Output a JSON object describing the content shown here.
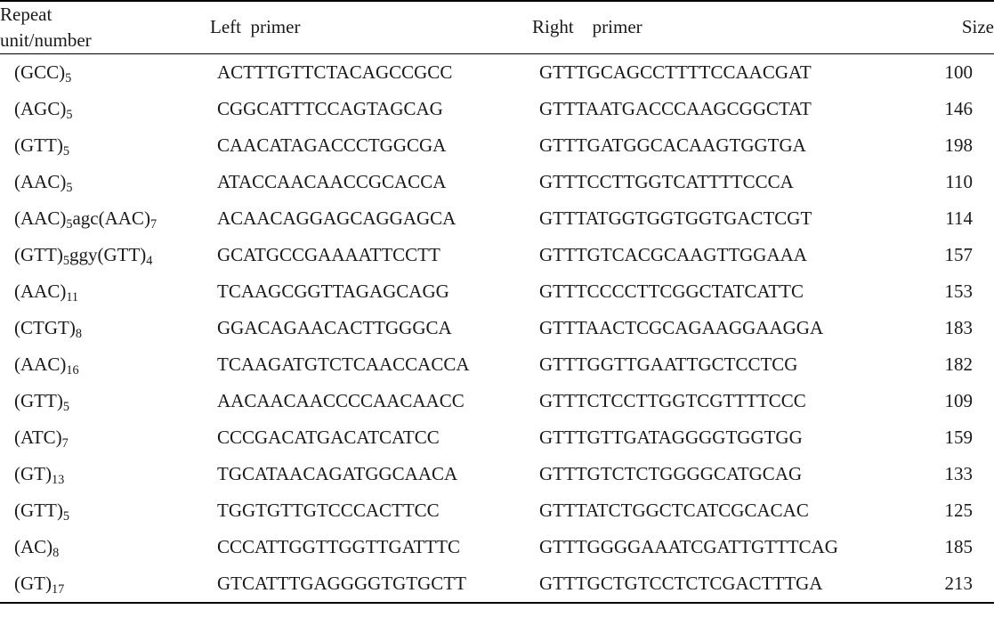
{
  "table": {
    "columns": [
      {
        "key": "repeat",
        "label_lines": [
          "Repeat",
          "unit/number"
        ],
        "align": "left"
      },
      {
        "key": "left_primer",
        "label": "Left  primer",
        "align": "left"
      },
      {
        "key": "right_primer",
        "label": "Right    primer",
        "align": "left"
      },
      {
        "key": "size",
        "label": "Size",
        "align": "right"
      }
    ],
    "rows": [
      {
        "repeat_unit": "(GCC)",
        "repeat_sub": "5",
        "repeat_extra": "",
        "repeat_display": "(GCC)5",
        "left_primer": "ACTTTGTTCTACAGCCGCC",
        "right_primer": "GTTTGCAGCCTTTTCCAACGAT",
        "size": "100"
      },
      {
        "repeat_unit": "(AGC)",
        "repeat_sub": "5",
        "repeat_extra": "",
        "repeat_display": "(AGC)5",
        "left_primer": "CGGCATTTCCAGTAGCAG",
        "right_primer": "GTTTAATGACCCAAGCGGCTAT",
        "size": "146"
      },
      {
        "repeat_unit": "(GTT)",
        "repeat_sub": "5",
        "repeat_extra": "",
        "repeat_display": "(GTT)5",
        "left_primer": "CAACATAGACCCTGGCGA",
        "right_primer": "GTTTGATGGCACAAGTGGTGA",
        "size": "198"
      },
      {
        "repeat_unit": "(AAC)",
        "repeat_sub": "5",
        "repeat_extra": "",
        "repeat_display": "(AAC)5",
        "left_primer": "ATACCAACAACCGCACCA",
        "right_primer": "GTTTCCTTGGTCATTTTCCCA",
        "size": "110"
      },
      {
        "repeat_unit": "(AAC)",
        "repeat_sub": "5",
        "repeat_extra": "agc(AAC)",
        "repeat_extra_sub": "7",
        "repeat_display": "(AAC)5agc(AAC)7",
        "left_primer": "ACAACAGGAGCAGGAGCA",
        "right_primer": "GTTTATGGTGGTGGTGACTCGT",
        "size": "114"
      },
      {
        "repeat_unit": "(GTT)",
        "repeat_sub": "5",
        "repeat_extra": "ggy(GTT)",
        "repeat_extra_sub": "4",
        "repeat_display": "(GTT)5ggy(GTT)4",
        "left_primer": "GCATGCCGAAAATTCCTT",
        "right_primer": "GTTTGTCACGCAAGTTGGAAA",
        "size": "157"
      },
      {
        "repeat_unit": "(AAC)",
        "repeat_sub": "11",
        "repeat_extra": "",
        "repeat_display": "(AAC)11",
        "left_primer": "TCAAGCGGTTAGAGCAGG",
        "right_primer": "GTTTCCCCTTCGGCTATCATTC",
        "size": "153"
      },
      {
        "repeat_unit": "(CTGT)",
        "repeat_sub": "8",
        "repeat_extra": "",
        "repeat_display": "(CTGT)8",
        "left_primer": "GGACAGAACACTTGGGCA",
        "right_primer": "GTTTAACTCGCAGAAGGAAGGA",
        "size": "183"
      },
      {
        "repeat_unit": "(AAC)",
        "repeat_sub": "16",
        "repeat_extra": "",
        "repeat_display": "(AAC)16",
        "left_primer": "TCAAGATGTCTCAACCACCA",
        "right_primer": "GTTTGGTTGAATTGCTCCTCG",
        "size": "182"
      },
      {
        "repeat_unit": "(GTT)",
        "repeat_sub": "5",
        "repeat_extra": "",
        "repeat_display": "(GTT)5",
        "left_primer": "AACAACAACCCCAACAACC",
        "right_primer": "GTTTCTCCTTGGTCGTTTTCCC",
        "size": "109"
      },
      {
        "repeat_unit": "(ATC)",
        "repeat_sub": "7",
        "repeat_extra": "",
        "repeat_display": "(ATC)7",
        "left_primer": "CCCGACATGACATCATCC",
        "right_primer": "GTTTGTTGATAGGGGTGGTGG",
        "size": "159"
      },
      {
        "repeat_unit": "(GT)",
        "repeat_sub": "13",
        "repeat_extra": "",
        "repeat_display": "(GT)13",
        "left_primer": "TGCATAACAGATGGCAACA",
        "right_primer": "GTTTGTCTCTGGGGCATGCAG",
        "size": "133"
      },
      {
        "repeat_unit": "(GTT)",
        "repeat_sub": "5",
        "repeat_extra": "",
        "repeat_display": "(GTT)5",
        "left_primer": "TGGTGTTGTCCCACTTCC",
        "right_primer": "GTTTATCTGGCTCATCGCACAC",
        "size": "125"
      },
      {
        "repeat_unit": "(AC)",
        "repeat_sub": "8",
        "repeat_extra": "",
        "repeat_display": "(AC)8",
        "left_primer": "CCCATTGGTTGGTTGATTTC",
        "right_primer": "GTTTGGGGAAATCGATTGTTTCAG",
        "size": "185"
      },
      {
        "repeat_unit": "(GT)",
        "repeat_sub": "17",
        "repeat_extra": "",
        "repeat_display": "(GT)17",
        "left_primer": "GTCATTTGAGGGGTGTGCTT",
        "right_primer": "GTTTGCTGTCCTCTCGACTTTGA",
        "size": "213"
      }
    ]
  },
  "colors": {
    "text": "#1a1a1a",
    "rule": "#000000",
    "background": "#ffffff"
  }
}
